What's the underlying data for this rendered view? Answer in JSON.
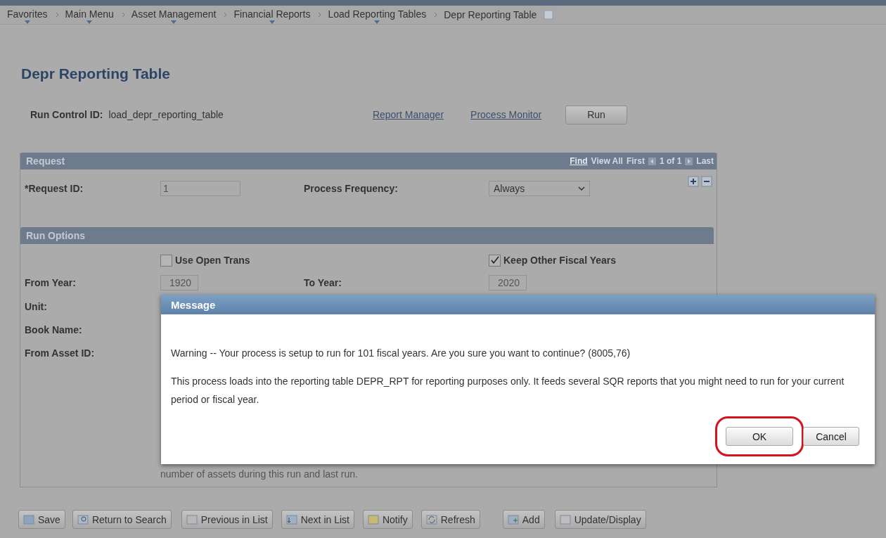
{
  "breadcrumbs": [
    {
      "label": "Favorites",
      "has_menu": true
    },
    {
      "label": "Main Menu",
      "has_menu": true
    },
    {
      "label": "Asset Management",
      "has_menu": true
    },
    {
      "label": "Financial Reports",
      "has_menu": true
    },
    {
      "label": "Load Reporting Tables",
      "has_menu": true
    },
    {
      "label": "Depr Reporting Table",
      "has_menu": false
    }
  ],
  "page_title": "Depr Reporting Table",
  "run_control": {
    "label": "Run Control ID:",
    "value": "load_depr_reporting_table"
  },
  "links": [
    "Report Manager",
    "Process Monitor"
  ],
  "run_button": "Run",
  "request": {
    "title": "Request",
    "nav": {
      "find": "Find",
      "view_all": "View All",
      "first": "First",
      "count": "1 of 1",
      "last": "Last"
    },
    "request_id": {
      "label": "*Request ID:",
      "value": "1"
    },
    "frequency": {
      "label": "Process Frequency:",
      "value": "Always"
    }
  },
  "run_options": {
    "title": "Run Options",
    "checkboxes": [
      {
        "label": "Use Open Trans",
        "checked": false
      },
      {
        "label": "Keep Other Fiscal Years",
        "checked": true
      }
    ],
    "from_year": {
      "label": "From Year:",
      "value": "1920"
    },
    "to_year": {
      "label": "To Year:",
      "value": "2020"
    },
    "labels": [
      "Unit:",
      "Book Name:",
      "From Asset ID:"
    ],
    "note": "number of assets during this run and last run."
  },
  "toolbar": [
    {
      "label": "Save"
    },
    {
      "label": "Return to Search"
    },
    {
      "label": "Previous in List"
    },
    {
      "label": "Next in List"
    },
    {
      "label": "Notify"
    },
    {
      "label": "Refresh"
    },
    {
      "label": "Add"
    },
    {
      "label": "Update/Display"
    }
  ],
  "dialog": {
    "title": "Message",
    "paragraphs": [
      "Warning -- Your process is setup to run for 101 fiscal years. Are you sure you want to continue? (8005,76)",
      "This process loads into the reporting table DEPR_RPT for reporting purposes only. It feeds several SQR reports that you might need to run for your current period or fiscal year."
    ],
    "buttons": [
      {
        "label": "OK",
        "highlighted": true
      },
      {
        "label": "Cancel",
        "highlighted": false
      }
    ]
  }
}
